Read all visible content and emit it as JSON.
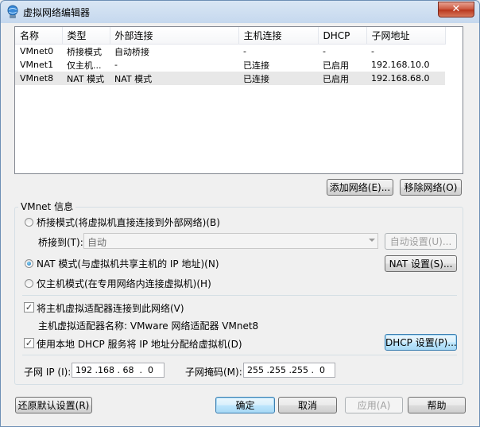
{
  "window": {
    "title": "虚拟网络编辑器",
    "close_label": "✕"
  },
  "table": {
    "columns": [
      "名称",
      "类型",
      "外部连接",
      "主机连接",
      "DHCP",
      "子网地址"
    ],
    "rows": [
      [
        "VMnet0",
        "桥接模式",
        "自动桥接",
        "-",
        "-",
        "-"
      ],
      [
        "VMnet1",
        "仅主机...",
        "-",
        "已连接",
        "已启用",
        "192.168.10.0"
      ],
      [
        "VMnet8",
        "NAT 模式",
        "NAT 模式",
        "已连接",
        "已启用",
        "192.168.68.0"
      ]
    ],
    "selected_row": 2
  },
  "list_buttons": {
    "add": "添加网络(E)...",
    "remove": "移除网络(O)"
  },
  "vmnet_info": {
    "legend": "VMnet 信息",
    "bridged_radio": "桥接模式(将虚拟机直接连接到外部网络)(B)",
    "bridge_to_label": "桥接到(T):",
    "bridge_to_value": "自动",
    "auto_settings": "自动设置(U)...",
    "nat_radio": "NAT 模式(与虚拟机共享主机的 IP 地址)(N)",
    "nat_settings": "NAT 设置(S)...",
    "hostonly_radio": "仅主机模式(在专用网络内连接虚拟机)(H)",
    "selected_mode": "nat",
    "connect_adapter_check": "将主机虚拟适配器连接到此网络(V)",
    "connect_adapter_checked": true,
    "adapter_name_line": "主机虚拟适配器名称: VMware 网络适配器 VMnet8",
    "dhcp_check": "使用本地 DHCP 服务将 IP 地址分配给虚拟机(D)",
    "dhcp_checked": true,
    "dhcp_settings": "DHCP 设置(P)...",
    "subnet_ip_label": "子网 IP (I):",
    "subnet_ip_value": "192 .168 . 68  .  0",
    "subnet_mask_label": "子网掩码(M):",
    "subnet_mask_value": "255 .255 .255 .  0"
  },
  "footer": {
    "restore_defaults": "还原默认设置(R)",
    "ok": "确定",
    "cancel": "取消",
    "apply": "应用(A)",
    "help": "帮助"
  },
  "colors": {
    "titlebar": "#c5d8ee",
    "selected_row": "#e8e8e8",
    "close_button": "#c9533a",
    "default_button": "#3c7fb1"
  }
}
